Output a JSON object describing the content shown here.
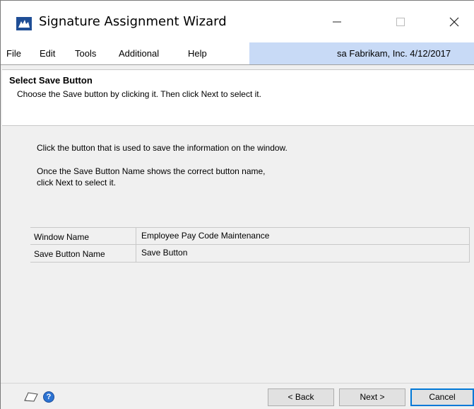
{
  "window": {
    "title": "Signature Assignment Wizard",
    "controls": {
      "minimize": "—",
      "maximize": "☐",
      "close": "✕"
    }
  },
  "menu": {
    "items": [
      "File",
      "Edit",
      "Tools",
      "Additional",
      "Help"
    ],
    "user_info": "sa  Fabrikam, Inc.  4/12/2017"
  },
  "step": {
    "title": "Select Save Button",
    "description": "Choose the Save button by clicking it. Then click Next to select it."
  },
  "instructions": {
    "line1": "Click the button that is used to save the information on the window.",
    "line2": "Once the Save Button Name shows the correct button name,",
    "line3": "click Next to select it."
  },
  "fields": [
    {
      "label": "Window Name",
      "value": "Employee Pay Code Maintenance"
    },
    {
      "label": "Save Button Name",
      "value": "Save Button"
    }
  ],
  "buttons": {
    "back": "< Back",
    "next": "Next >",
    "cancel": "Cancel"
  },
  "icons": {
    "app": "microsoft-dynamics-gp-icon",
    "note": "note-icon",
    "help": "help-icon"
  },
  "colors": {
    "menu_highlight": "#c8daf6",
    "default_button_border": "#0078d7"
  }
}
